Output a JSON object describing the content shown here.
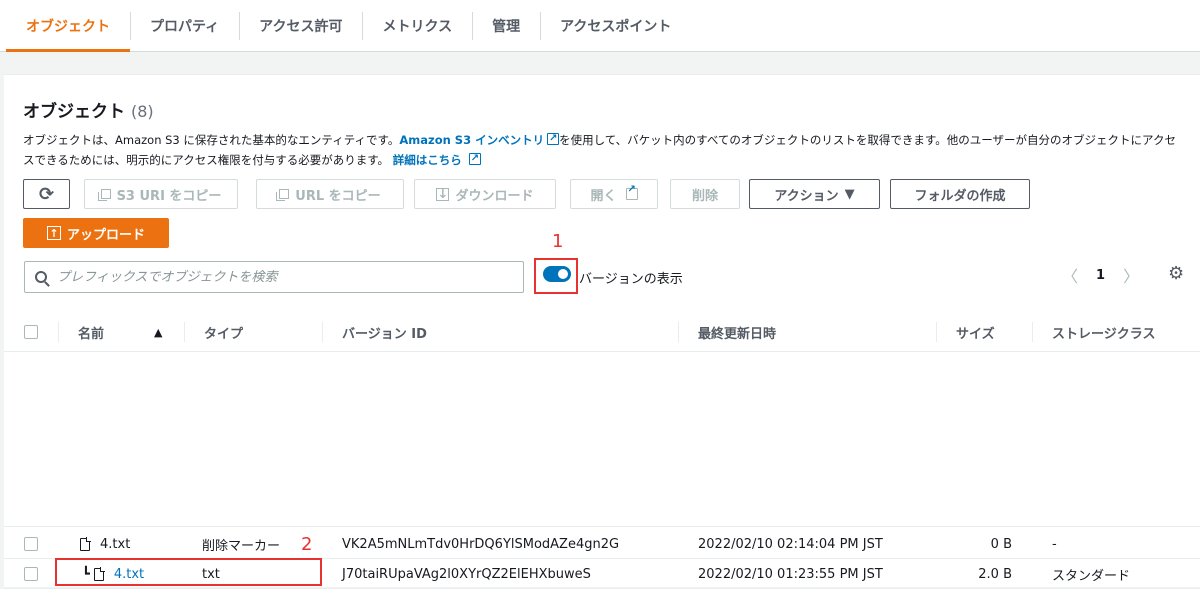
{
  "tabs": [
    "オブジェクト",
    "プロパティ",
    "アクセス許可",
    "メトリクス",
    "管理",
    "アクセスポイント"
  ],
  "panel": {
    "title": "オブジェクト",
    "count": "(8)",
    "desc_part1": "オブジェクトは、Amazon S3 に保存された基本的なエンティティです。",
    "desc_link1": "Amazon S3 インベントリ",
    "desc_part2": "を使用して、バケット内のすべてのオブジェクトのリストを取得できます。他のユーザーが自分のオブジェクトにアクセスできるためには、明示的にアクセス権限を付与する必要があります。",
    "desc_link2": "詳細はこちら"
  },
  "toolbar": {
    "refresh": "⟳",
    "copy_s3_uri": "S3 URI をコピー",
    "copy_url": "URL をコピー",
    "download": "ダウンロード",
    "open": "開く",
    "delete": "削除",
    "actions": "アクション",
    "actions_caret": "▼",
    "create_folder": "フォルダの作成",
    "upload": "アップロード"
  },
  "search": {
    "placeholder": "プレフィックスでオブジェクトを検索"
  },
  "versions_toggle": {
    "label": "バージョンの表示",
    "on": true
  },
  "annotations": {
    "one": "1",
    "two": "2"
  },
  "pager": {
    "prev": "〈",
    "page": "1",
    "next": "〉"
  },
  "table": {
    "headers": {
      "name": "名前",
      "sort": "▲",
      "type": "タイプ",
      "version_id": "バージョン ID",
      "modified": "最終更新日時",
      "size": "サイズ",
      "storage": "ストレージクラス"
    },
    "rows": [
      {
        "name": "4.txt",
        "type": "削除マーカー",
        "version_id": "VK2A5mNLmTdv0HrDQ6YlSModAZe4gn2G",
        "modified": "2022/02/10 02:14:04 PM JST",
        "size": "0 B",
        "storage": "-"
      },
      {
        "name": "4.txt",
        "type": "txt",
        "version_id": "J70taiRUpaVAg2l0XYrQZ2ElEHXbuweS",
        "modified": "2022/02/10 01:23:55 PM JST",
        "size": "2.0 B",
        "storage": "スタンダード"
      }
    ]
  },
  "colors": {
    "accent": "#ec7211",
    "link": "#0073bb",
    "annotation": "#e8322f"
  },
  "icons": [
    "refresh-icon",
    "copy-icon",
    "download-icon",
    "external-link-icon",
    "upload-icon",
    "search-icon",
    "gear-icon",
    "file-icon"
  ]
}
